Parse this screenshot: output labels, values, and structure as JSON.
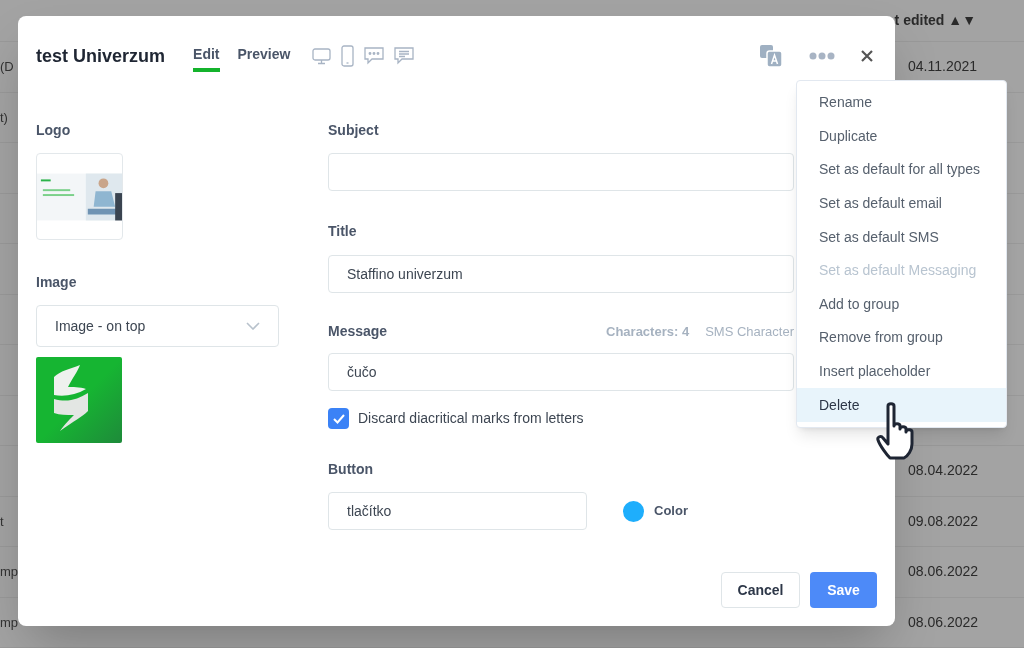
{
  "background_table": {
    "header": "t edited ▲▼",
    "rows": [
      {
        "column_1": "(D",
        "last_edited": "04.11.2021"
      },
      {
        "column_1": "t)"
      },
      {},
      {},
      {},
      {},
      {},
      {},
      {
        "last_edited": "08.04.2022"
      },
      {
        "column_1": "t",
        "last_edited": "09.08.2022"
      },
      {
        "column_1": "mp",
        "last_edited": "08.06.2022"
      },
      {
        "column_1": "mp",
        "last_edited": "08.06.2022"
      }
    ]
  },
  "dialog": {
    "title": "test Univerzum",
    "tabs": [
      {
        "label": "Edit",
        "selected": true
      },
      {
        "label": "Preview",
        "selected": false
      }
    ],
    "logo": {
      "label": "Logo"
    },
    "image": {
      "label": "Image",
      "value": "Image - on top"
    },
    "subject": {
      "label": "Subject"
    },
    "title_field": {
      "label": "Title",
      "value": "Staffino univerzum"
    },
    "message": {
      "label": "Message",
      "characters": "Characters: 4",
      "sms_characters": "SMS Character",
      "value": "čučo"
    },
    "discard_diacritics": {
      "label": "Discard diacritical marks from letters",
      "checked": true
    },
    "button": {
      "label": "Button",
      "value": "tlačítko",
      "color_label": "Color",
      "color": "#1eaefc"
    },
    "actions": [
      "Cancel",
      "Save"
    ]
  },
  "menu": {
    "items": [
      {
        "label": "Rename",
        "disabled": false,
        "highlighted": false
      },
      {
        "label": "Duplicate",
        "disabled": false,
        "highlighted": false
      },
      {
        "label": "Set as default for all types",
        "disabled": false,
        "highlighted": false
      },
      {
        "label": "Set as default email",
        "disabled": false,
        "highlighted": false
      },
      {
        "label": "Set as default SMS",
        "disabled": false,
        "highlighted": false
      },
      {
        "label": "Set as default Messaging",
        "disabled": true,
        "highlighted": false
      },
      {
        "label": "Add to group",
        "disabled": false,
        "highlighted": false
      },
      {
        "label": "Remove from group",
        "disabled": false,
        "highlighted": false
      },
      {
        "label": "Insert placeholder",
        "disabled": false,
        "highlighted": false
      },
      {
        "label": "Delete",
        "disabled": false,
        "highlighted": true
      }
    ]
  }
}
